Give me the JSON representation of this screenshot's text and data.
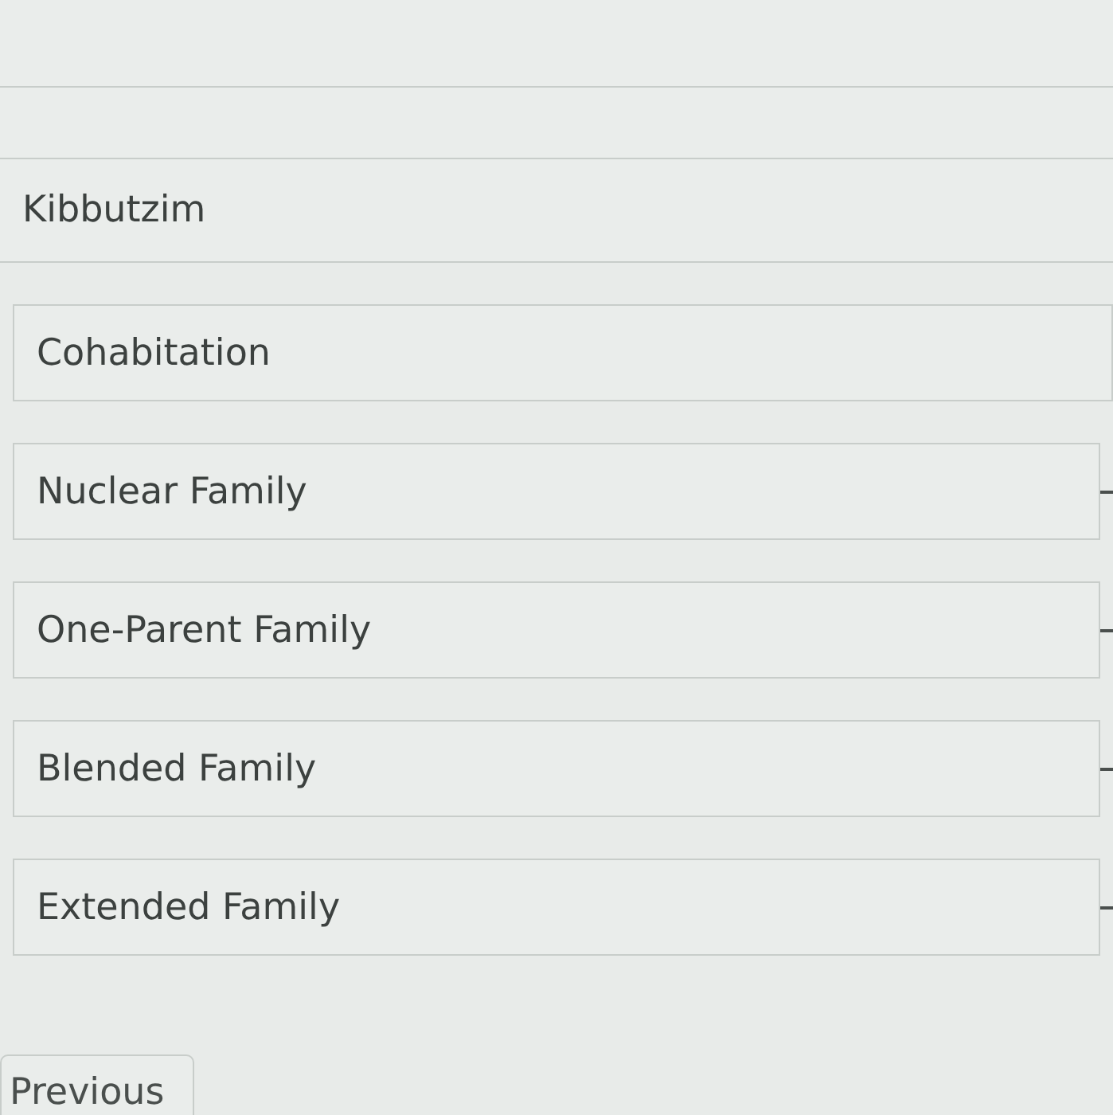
{
  "options": [
    {
      "kind": "blank",
      "answer_line": false
    },
    {
      "kind": "blank",
      "answer_line": false
    },
    {
      "kind": "row",
      "label": "Kibbutzim",
      "answer_line": false
    },
    {
      "kind": "box",
      "label": "Cohabitation",
      "answer_line": false
    },
    {
      "kind": "box",
      "label": "Nuclear Family",
      "answer_line": true
    },
    {
      "kind": "box",
      "label": "One-Parent Family",
      "answer_line": true
    },
    {
      "kind": "box",
      "label": "Blended Family",
      "answer_line": true
    },
    {
      "kind": "box",
      "label": "Extended Family",
      "answer_line": true
    }
  ],
  "previous_button": {
    "label": "Previous"
  }
}
